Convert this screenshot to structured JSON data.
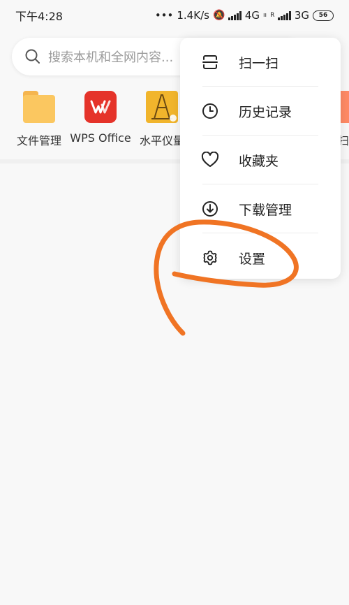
{
  "status_bar": {
    "time": "下午4:28",
    "dots": "•••",
    "speed": "1.4K/s",
    "net1": "4G",
    "net1_sub": "ıı",
    "roam": "R",
    "net2": "3G",
    "battery": "56"
  },
  "search": {
    "placeholder": "搜索本机和全网内容..."
  },
  "apps": [
    {
      "label": "文件管理",
      "icon": "folder-icon"
    },
    {
      "label": "WPS Office",
      "icon": "wps-icon"
    },
    {
      "label": "水平仪量",
      "icon": "level-icon"
    },
    {
      "label": "扫",
      "icon": "app-edge-icon"
    }
  ],
  "menu": {
    "items": [
      {
        "label": "扫一扫",
        "icon": "scan-icon"
      },
      {
        "label": "历史记录",
        "icon": "clock-icon"
      },
      {
        "label": "收藏夹",
        "icon": "heart-icon"
      },
      {
        "label": "下载管理",
        "icon": "download-icon"
      },
      {
        "label": "设置",
        "icon": "gear-icon"
      }
    ]
  },
  "colors": {
    "annotation": "#f07424",
    "wps": "#e5332a",
    "folder": "#fbc760",
    "level": "#f1b52c"
  }
}
